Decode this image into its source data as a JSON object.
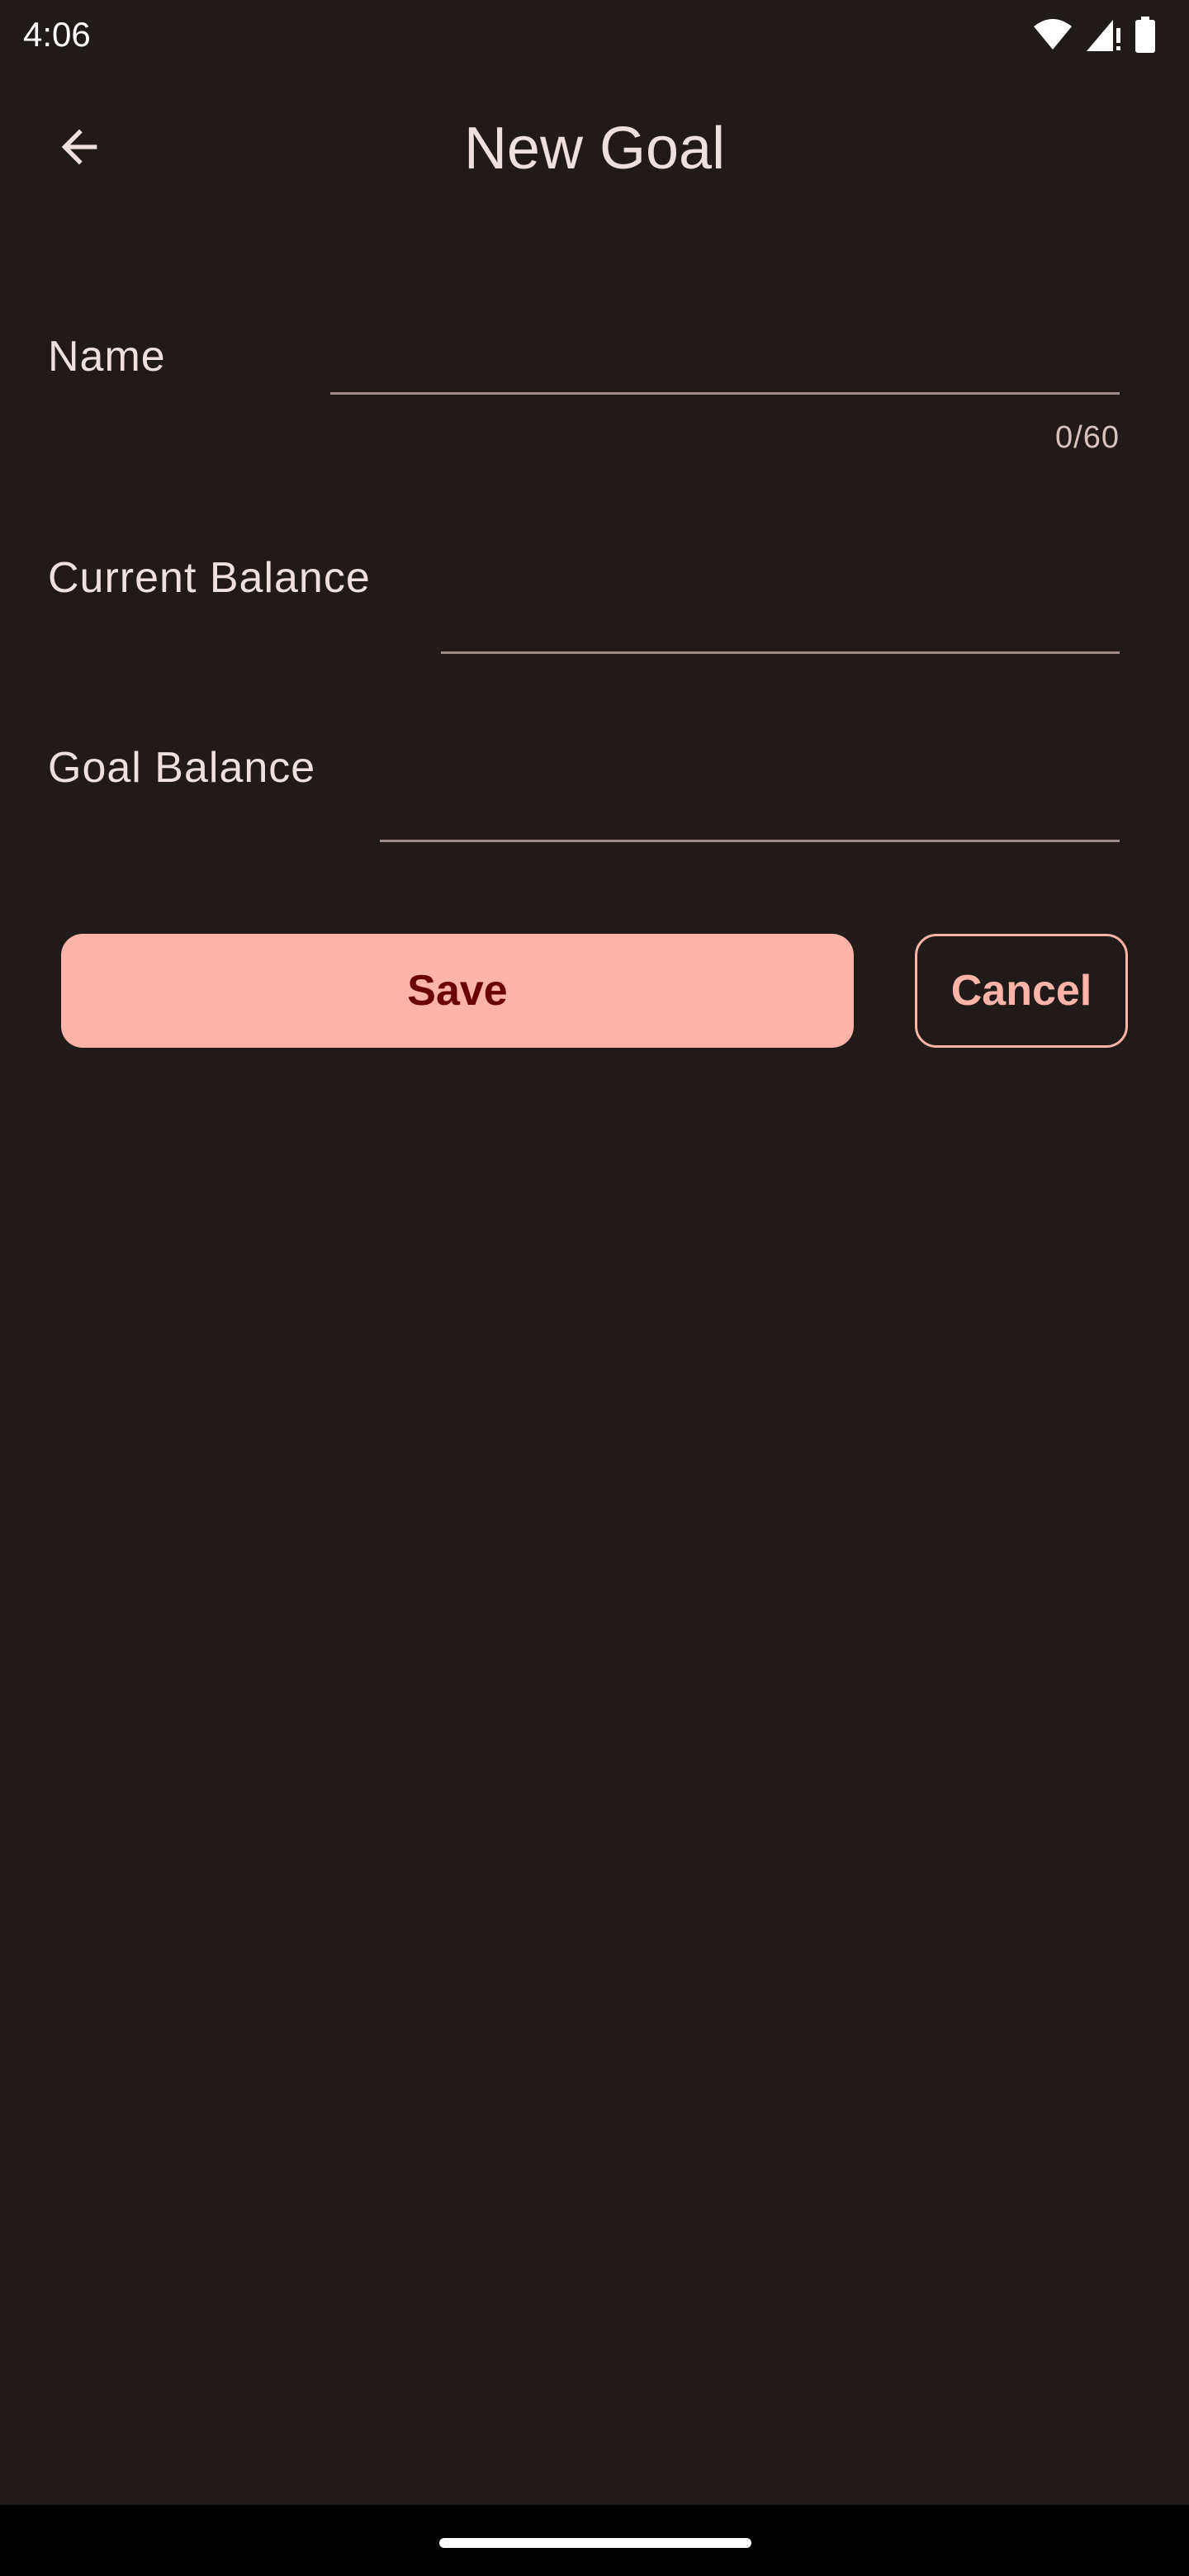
{
  "status_bar": {
    "time": "4:06",
    "icons": [
      "wifi-icon",
      "signal-icon",
      "battery-icon"
    ]
  },
  "top_bar": {
    "title": "New Goal",
    "back_icon": "arrow-back-icon"
  },
  "form": {
    "name": {
      "label": "Name",
      "value": "",
      "counter": "0/60"
    },
    "current_balance": {
      "label": "Current Balance",
      "value": ""
    },
    "goal_balance": {
      "label": "Goal Balance",
      "value": ""
    }
  },
  "actions": {
    "save_label": "Save",
    "cancel_label": "Cancel"
  },
  "colors": {
    "background": "#201a19",
    "primary": "#ffb4a9",
    "on_primary": "#690003",
    "text": "#ede0dd"
  }
}
